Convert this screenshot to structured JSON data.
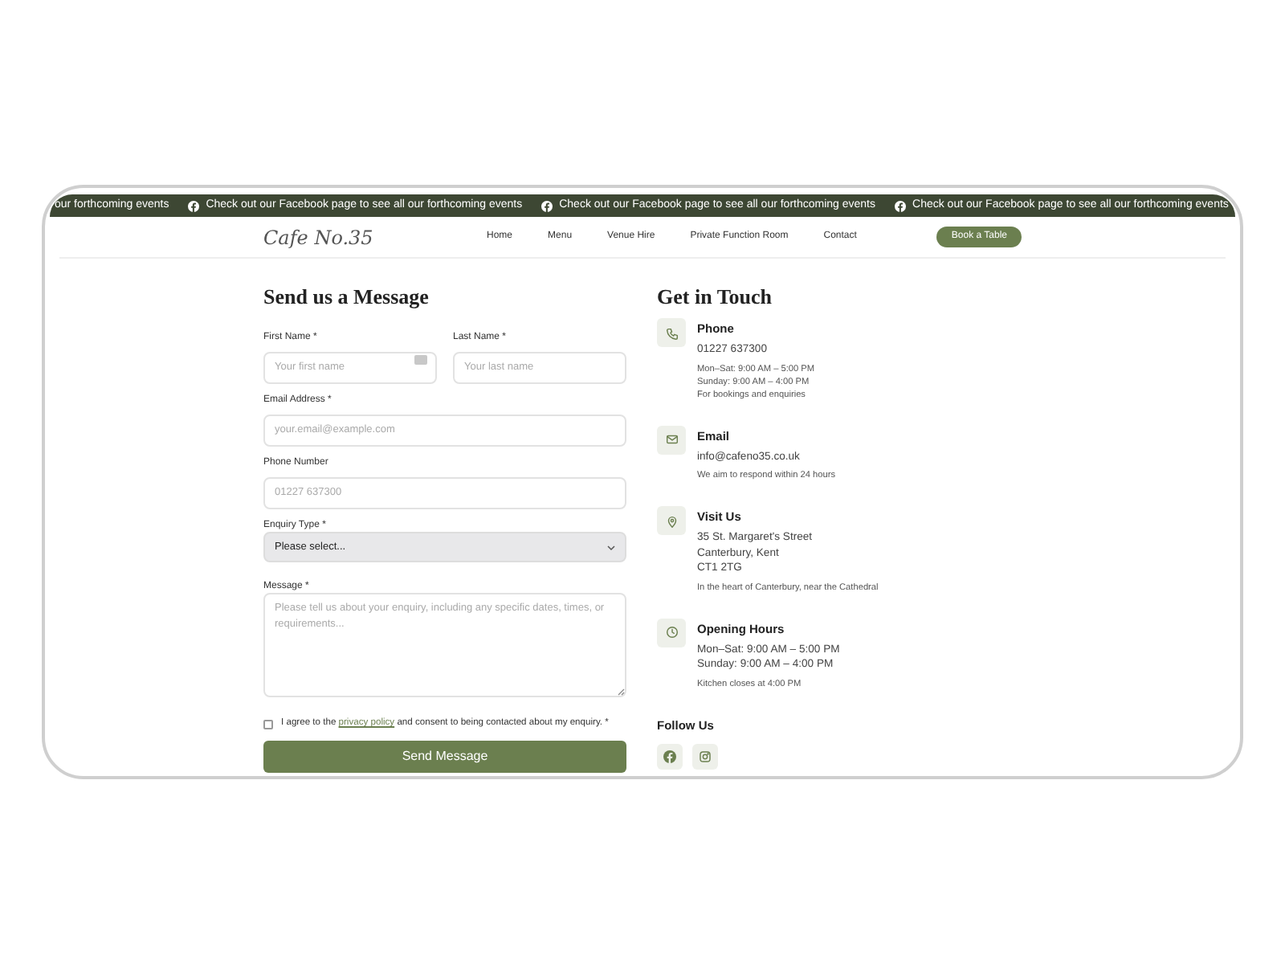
{
  "ticker": [
    "our forthcoming events",
    "Check out our Facebook page to see all our forthcoming events",
    "Check out our Facebook page to see all our forthcoming events",
    "Check out our Facebook page to see all our forthcoming events"
  ],
  "logo": "Cafe No.35",
  "nav": [
    {
      "label": "Home"
    },
    {
      "label": "Menu"
    },
    {
      "label": "Venue Hire"
    },
    {
      "label": "Private Function Room"
    },
    {
      "label": "Contact"
    }
  ],
  "nav_button": "Book a Table",
  "form": {
    "title": "Send us a Message",
    "rows": [
      [
        {
          "kind": "text-with-icon",
          "label": "First Name *",
          "placeholder": "Your first name"
        },
        {
          "kind": "text",
          "label": "Last Name *",
          "placeholder": "Your last name"
        }
      ],
      [
        {
          "kind": "text",
          "label": "Email Address *",
          "placeholder": "your.email@example.com"
        }
      ],
      [
        {
          "kind": "text",
          "label": "Phone Number",
          "placeholder": "01227 637300"
        }
      ],
      [
        {
          "kind": "select",
          "label": "Enquiry Type *",
          "value": "Please select..."
        }
      ],
      [
        {
          "kind": "textarea",
          "label": "Message *",
          "placeholder": "Please tell us about your enquiry, including any specific dates, times, or requirements..."
        }
      ]
    ],
    "consent": {
      "checked": false,
      "before": "I agree to the",
      "link": "privacy policy",
      "after": "and consent to being contacted about my enquiry. *"
    },
    "submit": "Send Message"
  },
  "contact": {
    "title": "Get in Touch",
    "items": [
      {
        "kind": "phone",
        "title": "Phone",
        "lines": [
          {
            "kind": "main",
            "text": "01227 637300"
          },
          {
            "kind": "note",
            "text": "Mon–Sat: 9:00 AM – 5:00 PM"
          },
          {
            "kind": "note",
            "text": "Sunday: 9:00 AM – 4:00 PM"
          },
          {
            "kind": "note",
            "text": "For bookings and enquiries"
          }
        ]
      },
      {
        "kind": "email",
        "title": "Email",
        "lines": [
          {
            "kind": "main",
            "text": "info@cafeno35.co.uk"
          },
          {
            "kind": "note",
            "text": "We aim to respond within 24 hours"
          }
        ]
      },
      {
        "kind": "location",
        "title": "Visit Us",
        "lines": [
          {
            "kind": "main",
            "text": "35 St. Margaret's Street"
          },
          {
            "kind": "main",
            "text": "Canterbury, Kent"
          },
          {
            "kind": "main",
            "text": "CT1 2TG"
          },
          {
            "kind": "note",
            "text": "In the heart of Canterbury, near the Cathedral"
          }
        ]
      },
      {
        "kind": "clock",
        "title": "Opening Hours",
        "lines": [
          {
            "kind": "main",
            "text": "Mon–Sat: 9:00 AM – 5:00 PM"
          },
          {
            "kind": "main",
            "text": "Sunday: 9:00 AM – 4:00 PM"
          },
          {
            "kind": "note",
            "text": "Kitchen closes at 4:00 PM"
          }
        ]
      }
    ],
    "follow_title": "Follow Us",
    "socials": [
      {
        "kind": "facebook"
      },
      {
        "kind": "instagram"
      }
    ]
  }
}
